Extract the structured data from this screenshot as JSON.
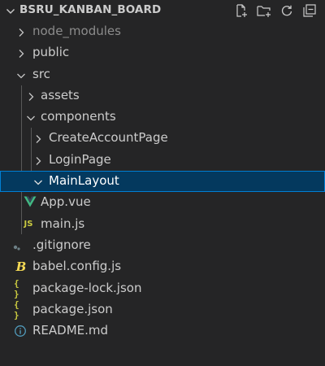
{
  "explorer": {
    "title": "BSRU_KANBAN_BOARD",
    "actions": [
      {
        "name": "new-file-icon"
      },
      {
        "name": "new-folder-icon"
      },
      {
        "name": "refresh-icon"
      },
      {
        "name": "collapse-all-icon"
      }
    ]
  },
  "tree": {
    "items": [
      {
        "label": "node_modules",
        "type": "folder",
        "expanded": false,
        "depth": 0,
        "dimmed": true
      },
      {
        "label": "public",
        "type": "folder",
        "expanded": false,
        "depth": 0
      },
      {
        "label": "src",
        "type": "folder",
        "expanded": true,
        "depth": 0
      },
      {
        "label": "assets",
        "type": "folder",
        "expanded": false,
        "depth": 1
      },
      {
        "label": "components",
        "type": "folder",
        "expanded": true,
        "depth": 1
      },
      {
        "label": "CreateAccountPage",
        "type": "folder",
        "expanded": false,
        "depth": 2
      },
      {
        "label": "LoginPage",
        "type": "folder",
        "expanded": false,
        "depth": 2
      },
      {
        "label": "MainLayout",
        "type": "folder",
        "expanded": true,
        "depth": 2,
        "selected": true
      },
      {
        "label": "App.vue",
        "type": "file",
        "icon": "vue-icon",
        "depth": 1
      },
      {
        "label": "main.js",
        "type": "file",
        "icon": "js-icon",
        "depth": 1
      },
      {
        "label": ".gitignore",
        "type": "file",
        "icon": "git-icon",
        "depth": 0
      },
      {
        "label": "babel.config.js",
        "type": "file",
        "icon": "babel-icon",
        "depth": 0
      },
      {
        "label": "package-lock.json",
        "type": "file",
        "icon": "json-icon",
        "depth": 0
      },
      {
        "label": "package.json",
        "type": "file",
        "icon": "json-icon",
        "depth": 0
      },
      {
        "label": "README.md",
        "type": "file",
        "icon": "info-icon",
        "depth": 0
      }
    ],
    "js_badge": "JS",
    "json_badge": "{ }"
  },
  "colors": {
    "background": "#252526",
    "selection": "#04395e",
    "selection_border": "#007fd4",
    "text": "#cccccc",
    "dim_text": "#8c8c8c",
    "vue_green": "#42b883",
    "js_yellow": "#cbcb41",
    "babel_yellow": "#f5da55",
    "json_yellow": "#cbcb41",
    "info_blue": "#519aba",
    "git_gray": "#6d8086"
  }
}
